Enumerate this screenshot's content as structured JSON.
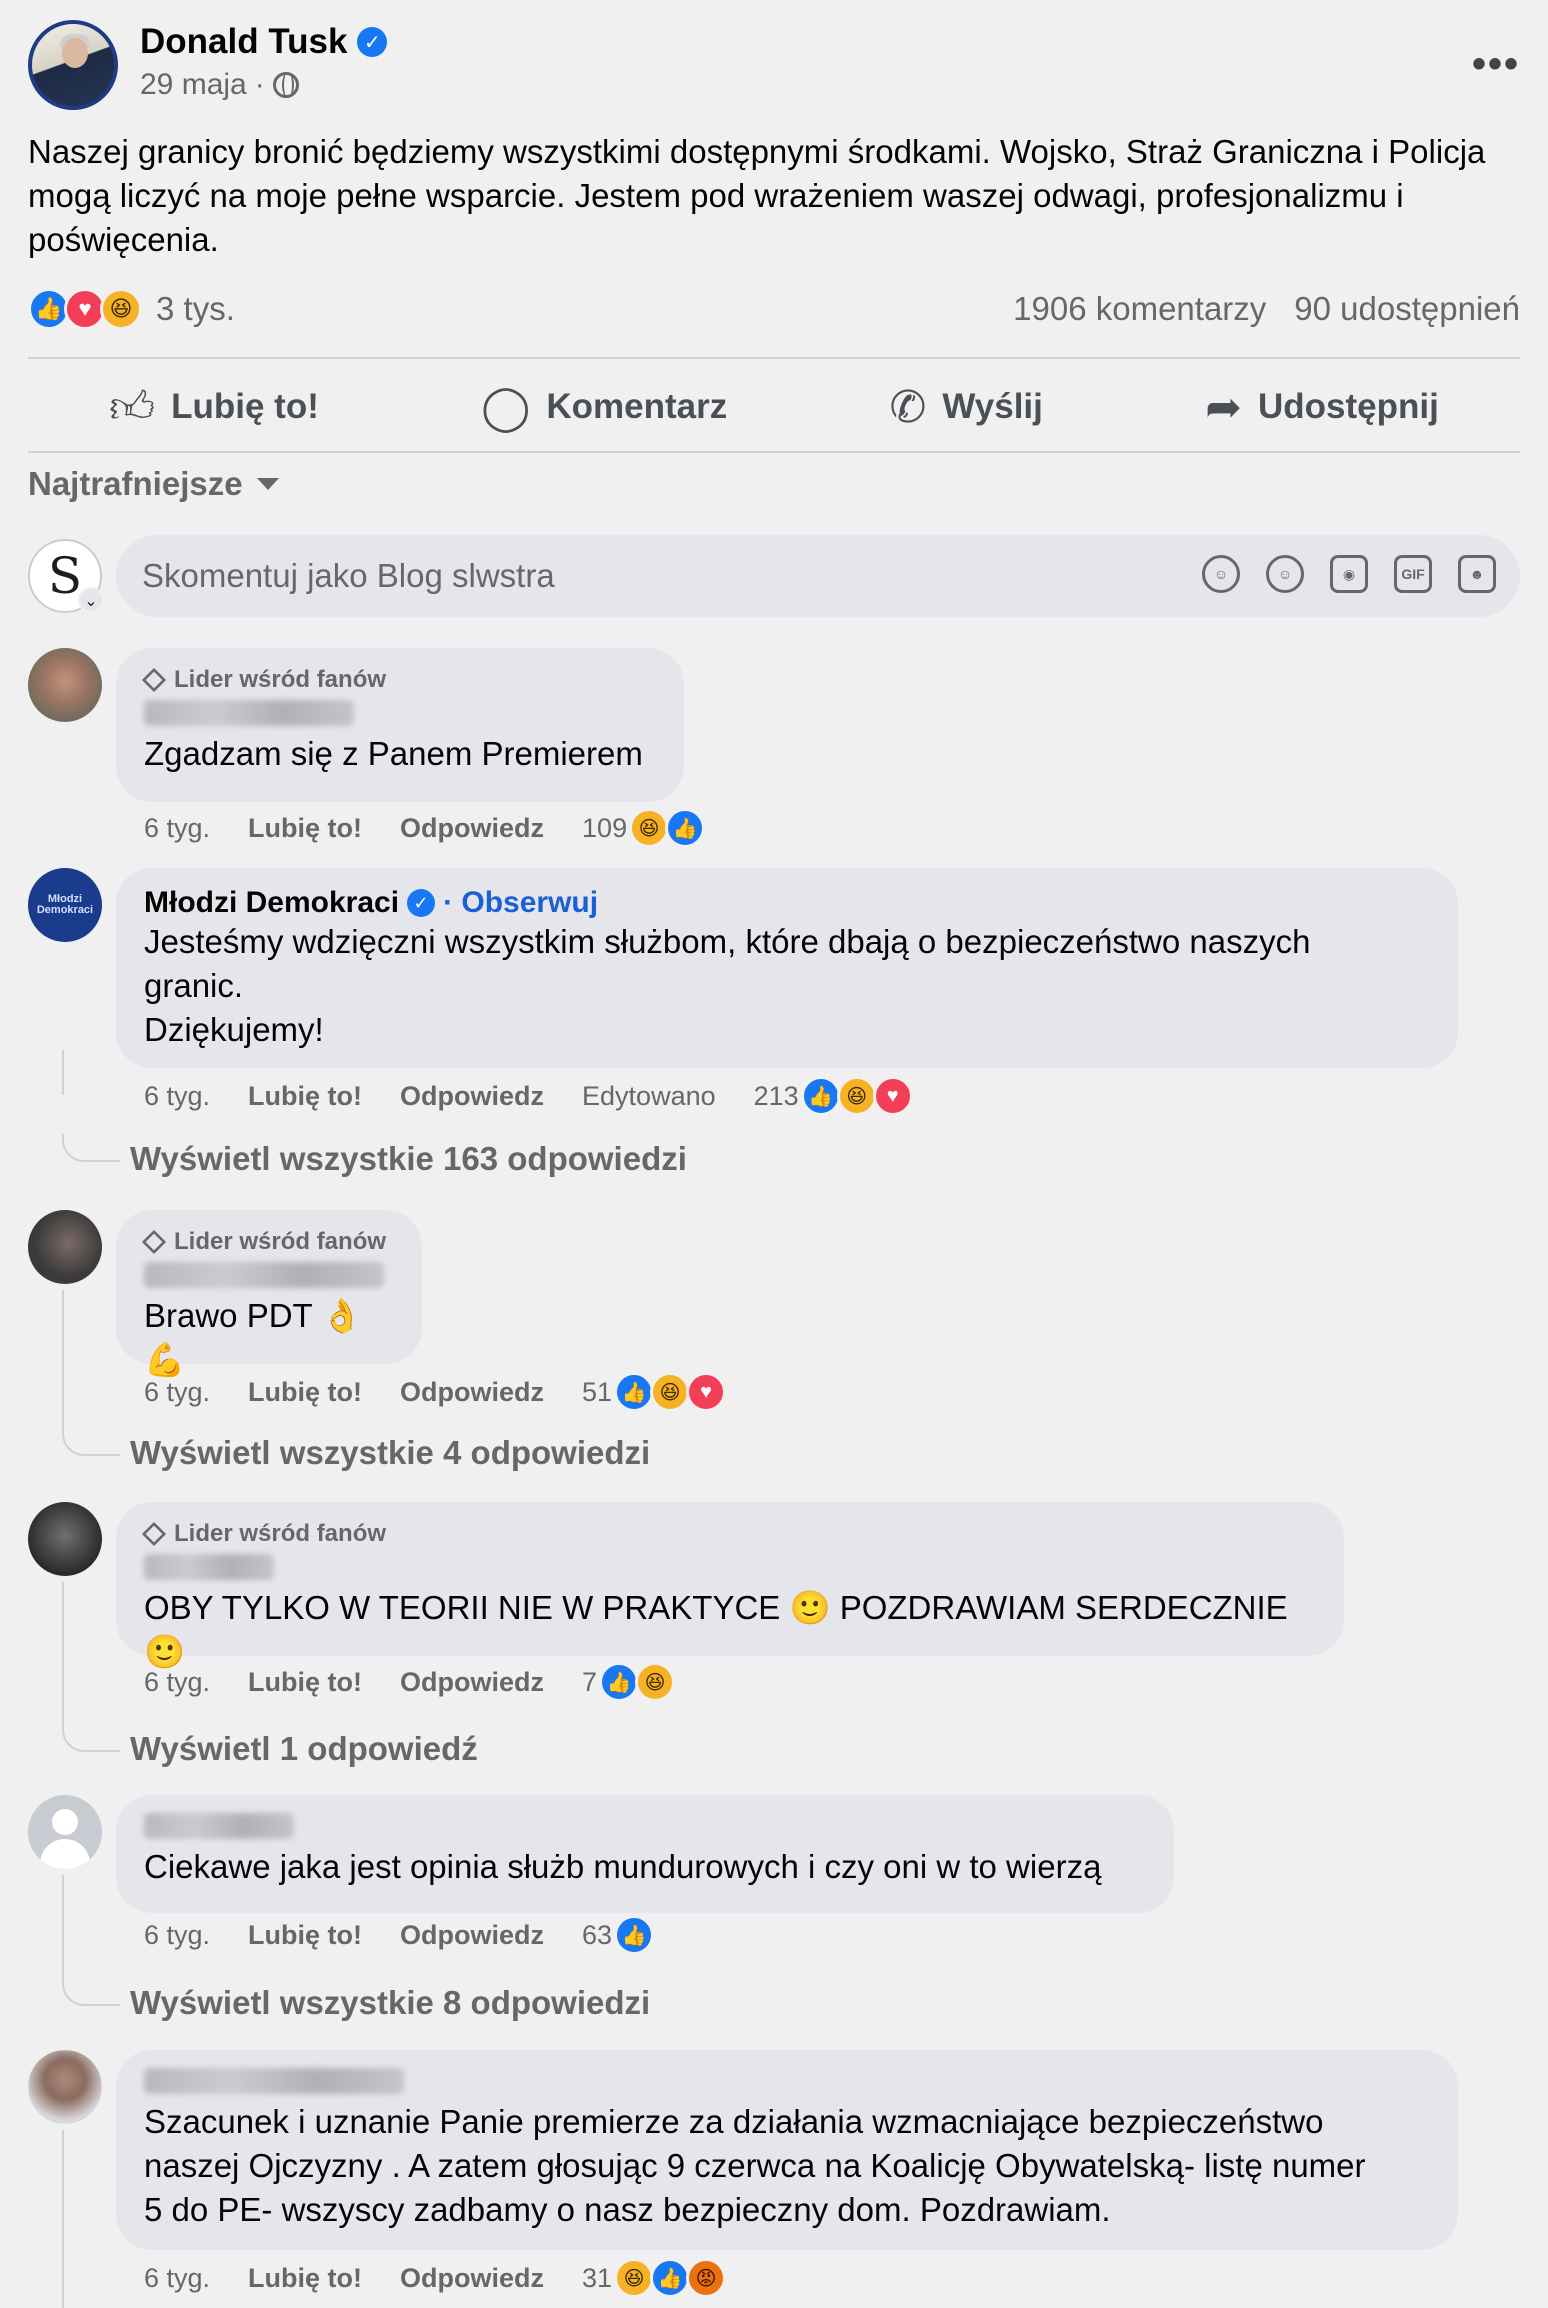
{
  "post": {
    "author": "Donald Tusk",
    "date": "29 maja",
    "text": "Naszej granicy bronić będziemy wszystkimi dostępnymi środkami. Wojsko, Straż Graniczna i Policja mogą liczyć na moje pełne wsparcie. Jestem pod wrażeniem waszej odwagi, profesjonalizmu i poświęcenia.",
    "reaction_count": "3 tys.",
    "comment_count": "1906 komentarzy",
    "share_count": "90 udostępnień",
    "reaction_icons": [
      "like-icon",
      "love-icon",
      "haha-icon"
    ]
  },
  "actions": {
    "like": "Lubię to!",
    "comment": "Komentarz",
    "send": "Wyślij",
    "share": "Udostępnij"
  },
  "sort_label": "Najtrafniejsze",
  "composer": {
    "avatar_letter": "S",
    "placeholder": "Skomentuj jako Blog slwstra",
    "tools": [
      "avatar-sticker-icon",
      "emoji-icon",
      "camera-icon",
      "gif-icon",
      "sticker-icon"
    ],
    "gif_label": "GIF"
  },
  "comment_labels": {
    "fan_badge": "Lider wśród fanów",
    "like": "Lubię to!",
    "reply": "Odpowiedz",
    "edited": "Edytowano",
    "follow": "Obserwuj"
  },
  "comments": [
    {
      "text": "Zgadzam się z Panem Premierem",
      "time": "6 tyg.",
      "count": "109"
    },
    {
      "author": "Młodzi Demokraci",
      "avatar_text": "Młodzi Demokraci",
      "text1": "Jesteśmy wdzięczni wszystkim służbom, które dbają o bezpieczeństwo naszych",
      "text2": "granic.",
      "text3": "Dziękujemy!",
      "time": "6 tyg.",
      "count": "213",
      "replies": "Wyświetl wszystkie 163 odpowiedzi"
    },
    {
      "text": "Brawo PDT 👌💪",
      "time": "6 tyg.",
      "count": "51",
      "replies": "Wyświetl wszystkie 4 odpowiedzi"
    },
    {
      "text": "OBY TYLKO W TEORII NIE W PRAKTYCE 🙂 POZDRAWIAM SERDECZNIE 🙂",
      "time": "6 tyg.",
      "count": "7",
      "replies": "Wyświetl 1 odpowiedź"
    },
    {
      "text": "Ciekawe jaka jest opinia służb mundurowych i czy oni w to wierzą",
      "time": "6 tyg.",
      "count": "63",
      "replies": "Wyświetl wszystkie 8 odpowiedzi"
    },
    {
      "text1": "Szacunek i uznanie Panie premierze za działania wzmacniające bezpieczeństwo",
      "text2": "naszej Ojczyzny . A zatem głosując 9 czerwca na Koalicję Obywatelską- listę numer",
      "text3": "5 do PE- wszyscy zadbamy o nasz bezpieczny dom. Pozdrawiam.",
      "time": "6 tyg.",
      "count": "31"
    }
  ],
  "colors": {
    "accent": "#1877f2",
    "background": "#f0f0f0",
    "bubble": "#e4e6eb",
    "muted": "#65676b"
  }
}
